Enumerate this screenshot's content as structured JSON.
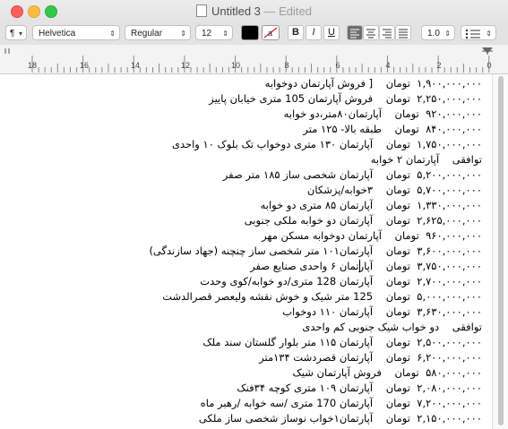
{
  "window": {
    "title": "Untitled 3",
    "status": " — Edited"
  },
  "toolbar": {
    "paragraph_label": "¶",
    "font_family": "Helvetica",
    "font_style": "Regular",
    "font_size": "12",
    "bold_label": "B",
    "italic_label": "I",
    "underline_label": "U",
    "line_spacing": "1.0",
    "text_color": "#000000"
  },
  "ruler": {
    "labels": [
      "18",
      "16",
      "14",
      "12",
      "10",
      "8",
      "6",
      "4",
      "2",
      "0"
    ]
  },
  "document": {
    "lines": [
      "۱,۹۰۰,۰۰۰,۰۰۰  تومان    [ فروش آپارتمان دوخوابه",
      "۲,۲۵۰,۰۰۰,۰۰۰  تومان    فروش آپارتمان 105 متری خیابان پاییز",
      "۹۲۰,۰۰۰,۰۰۰  تومان    آپارتمان۸۰متر،دو خوابه",
      "۸۴۰,۰۰۰,۰۰۰  تومان    طبقه بالا- ۱۲۵ متر",
      "۱,۷۵۰,۰۰۰,۰۰۰  تومان    آپارتمان ۱۳۰ متری دوخواب تک بلوک ۱۰ واحدی",
      "توافقی    آپارتمان ۲ خوابه",
      "۵,۲۰۰,۰۰۰,۰۰۰  تومان    آپارتمان شخصی ساز ۱۸۵ متر صفر",
      "۵,۷۰۰,۰۰۰,۰۰۰  تومان    ۳خوابه/پزشکان",
      "۱,۳۳۰,۰۰۰,۰۰۰  تومان    آپارتمان ۸۵ متری دو خوابه",
      "۲,۶۲۵,۰۰۰,۰۰۰  تومان    آپارتمان دو خوابه ملکی جنوبی",
      "۹۶۰,۰۰۰,۰۰۰  تومان    آپارتمان دوخوابه مسکن مهر",
      "۳,۶۰۰,۰۰۰,۰۰۰  تومان    آپارتمان۱۰۱ متر شخصی ساز چنچنه (جهاد سازندگی)",
      "۳,۷۵۰,۰۰۰,۰۰۰  تومان    آپارتمان ۶ واحدی صنایع صفر",
      "۲,۷۰۰,۰۰۰,۰۰۰  تومان    آپارتمان 128 متری/دو خوابه/کوی وحدت",
      "۵,۰۰۰,۰۰۰,۰۰۰  تومان    125 متر شیک و خوش نقشه ولیعصر قصرالدشت",
      "۳,۶۳۰,۰۰۰,۰۰۰  تومان    آپارتمان ۱۱۰ دوخواب",
      "توافقی    دو خواب شیک جنوبی کم واحدی",
      "۲,۵۰۰,۰۰۰,۰۰۰  تومان    آپارتمان ۱۱۵ متر بلوار گلستان سند ملک",
      "۶,۲۰۰,۰۰۰,۰۰۰  تومان    آپارتمان قصردشت ۱۳۴متر",
      "۵۸۰,۰۰۰,۰۰۰  تومان    فروش آپارتمان شیک",
      "۲,۰۸۰,۰۰۰,۰۰۰  تومان    آپارتمان ۱۰۹ متری کوچه ۳۴فنک",
      "۷,۲۰۰,۰۰۰,۰۰۰  تومان    آپارتمان 170 متری /سه خوابه /رهبر ماه",
      "۲,۱۵۰,۰۰۰,۰۰۰  تومان    آپارتمان۱خواب نوساز شخصی ساز ملکی"
    ]
  }
}
